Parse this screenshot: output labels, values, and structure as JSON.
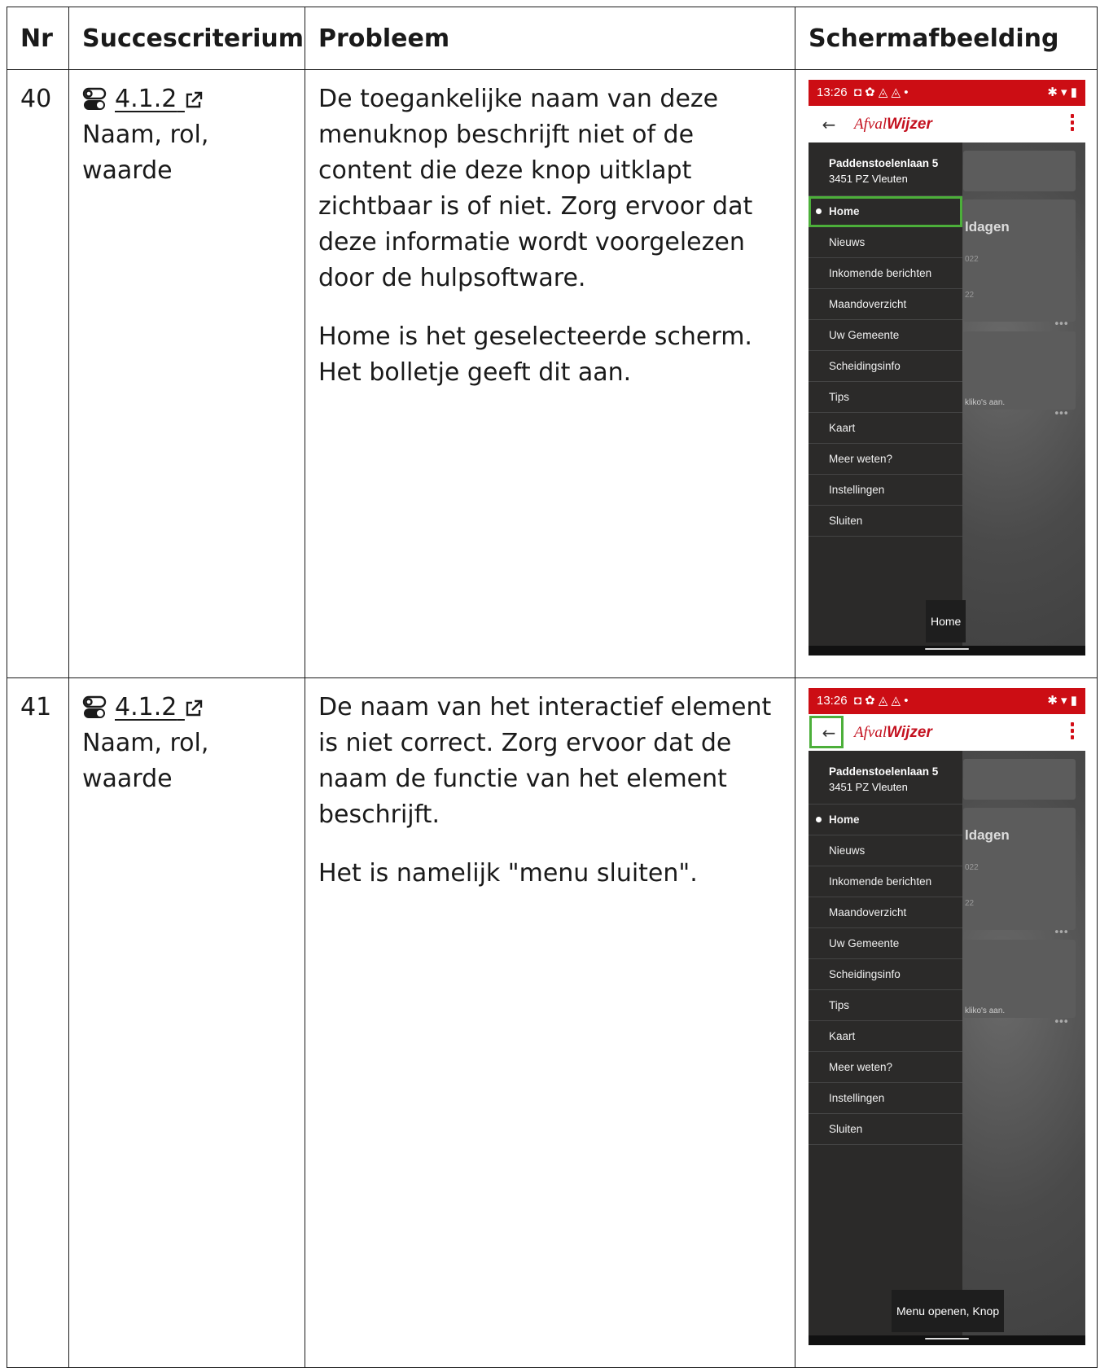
{
  "headers": {
    "nr": "Nr",
    "criterion": "Succescriterium",
    "problem": "Probleem",
    "screenshot": "Schermafbeelding"
  },
  "rows": [
    {
      "nr": "40",
      "criterion_code": "4.1.2",
      "criterion_name": "Naam, rol, waarde",
      "problem": [
        "De toegankelijke naam van deze menuknop beschrijft niet of de content die deze knop uitklapt zichtbaar is of niet. Zorg ervoor dat deze informatie wordt voorgelezen door de hulpsoftware.",
        "Home is het geselecteerde scherm. Het bolletje geeft dit aan."
      ],
      "tooltip": "Home"
    },
    {
      "nr": "41",
      "criterion_code": "4.1.2",
      "criterion_name": "Naam, rol, waarde",
      "problem": [
        "De naam van het interactief element is niet correct. Zorg ervoor dat de naam de functie van het element beschrijft.",
        "Het is namelijk \"menu sluiten\"."
      ],
      "tooltip": "Menu openen, Knop"
    }
  ],
  "phone": {
    "time": "13:26",
    "status_icons_left": "◘ ✿ ◬ ◬ •",
    "status_icons_right": "✱ ▾ ▮",
    "back_icon": "←",
    "app_logo_light": "Afval",
    "app_logo_bold": "Wijzer",
    "address_line1": "Paddenstoelenlaan 5",
    "address_line2": "3451 PZ Vleuten",
    "menu": [
      "Home",
      "Nieuws",
      "Inkomende berichten",
      "Maandoverzicht",
      "Uw Gemeente",
      "Scheidingsinfo",
      "Tips",
      "Kaart",
      "Meer weten?",
      "Instellingen",
      "Sluiten"
    ],
    "card_title": "ldagen",
    "card_sub1": "022",
    "card_sub2": "22",
    "card2_text": "kliko's aan.",
    "dots": "•••"
  },
  "colors": {
    "status_red": "#cc0d14",
    "focus_green": "#4caf3a",
    "drawer": "#2b2a29"
  }
}
